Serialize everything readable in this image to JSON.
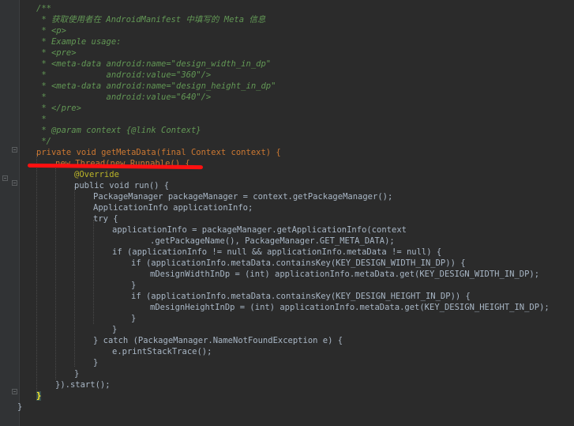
{
  "editor": {
    "language": "Java",
    "theme": "Darcula",
    "annotation_color": "#ff1010",
    "lines": [
      "/**",
      " * 获取使用者在 AndroidManifest 中填写的 Meta 信息",
      " * <p>",
      " * Example usage:",
      " * <pre>",
      " * <meta-data android:name=\"design_width_in_dp\"",
      " *            android:value=\"360\"/>",
      " * <meta-data android:name=\"design_height_in_dp\"",
      " *            android:value=\"640\"/>",
      " * </pre>",
      " *",
      " * @param context {@link Context}",
      " */",
      "private void getMetaData(final Context context) {",
      "new Thread(new Runnable() {",
      "@Override",
      "public void run() {",
      "PackageManager packageManager = context.getPackageManager();",
      "ApplicationInfo applicationInfo;",
      "try {",
      "applicationInfo = packageManager.getApplicationInfo(context",
      ".getPackageName(), PackageManager.GET_META_DATA);",
      "if (applicationInfo != null && applicationInfo.metaData != null) {",
      "if (applicationInfo.metaData.containsKey(KEY_DESIGN_WIDTH_IN_DP)) {",
      "mDesignWidthInDp = (int) applicationInfo.metaData.get(KEY_DESIGN_WIDTH_IN_DP);",
      "}",
      "if (applicationInfo.metaData.containsKey(KEY_DESIGN_HEIGHT_IN_DP)) {",
      "mDesignHeightInDp = (int) applicationInfo.metaData.get(KEY_DESIGN_HEIGHT_IN_DP);",
      "}",
      "}",
      "} catch (PackageManager.NameNotFoundException e) {",
      "e.printStackTrace();",
      "}",
      "}",
      "}).start();",
      "}",
      "}"
    ]
  }
}
